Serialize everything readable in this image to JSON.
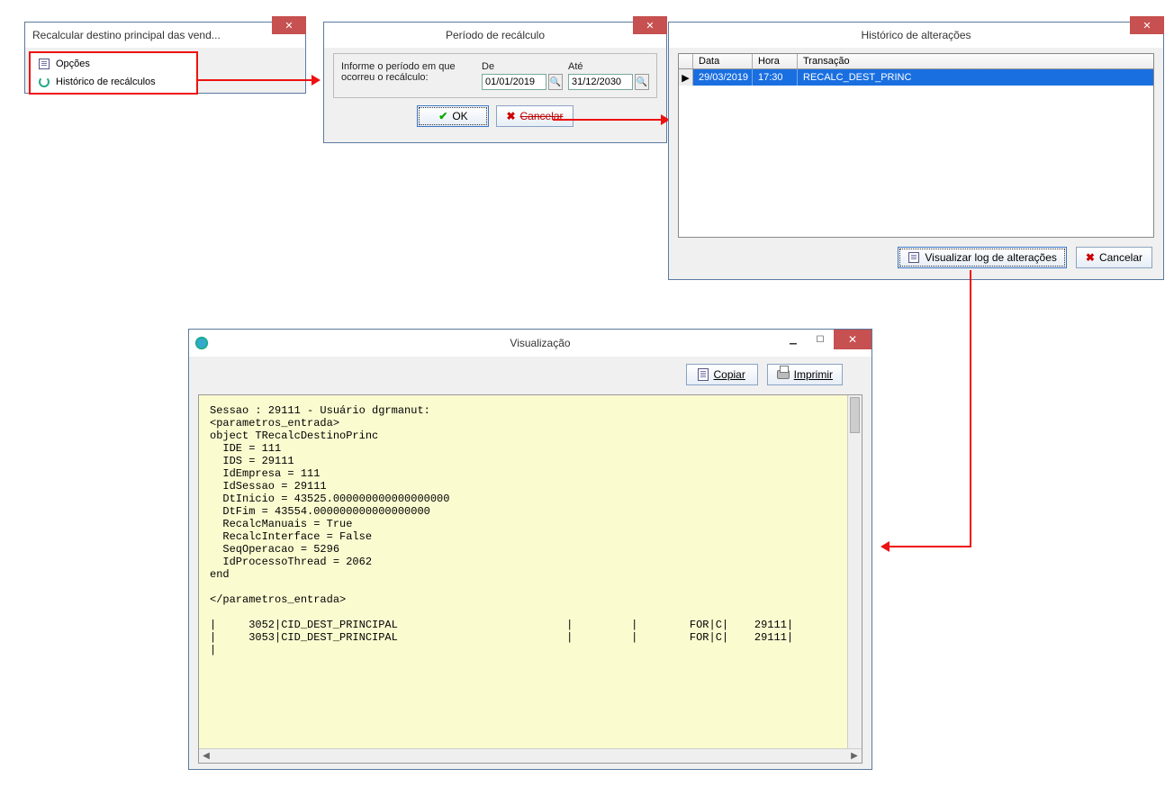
{
  "win1": {
    "title": "Recalcular destino principal das vend...",
    "menu": {
      "opcoes": "Opções",
      "historico": "Histórico de recálculos"
    }
  },
  "win2": {
    "title": "Período de recálculo",
    "instruction": "Informe o período em que ocorreu o recálculo:",
    "de_label": "De",
    "ate_label": "Até",
    "de_value": "01/01/2019",
    "ate_value": "31/12/2030",
    "ok": "OK",
    "cancel": "Cancelar"
  },
  "win3": {
    "title": "Histórico de alterações",
    "headers": {
      "data": "Data",
      "hora": "Hora",
      "transacao": "Transação"
    },
    "rows": [
      {
        "data": "29/03/2019",
        "hora": "17:30",
        "transacao": "RECALC_DEST_PRINC"
      }
    ],
    "btn_view": "Visualizar log de alterações",
    "btn_cancel": "Cancelar"
  },
  "win4": {
    "title": "Visualização",
    "btn_copy": "Copiar",
    "btn_print": "Imprimir",
    "log": "Sessao : 29111 - Usuário dgrmanut:\n<parametros_entrada>\nobject TRecalcDestinoPrinc\n  IDE = 111\n  IDS = 29111\n  IdEmpresa = 111\n  IdSessao = 29111\n  DtInicio = 43525.000000000000000000\n  DtFim = 43554.000000000000000000\n  RecalcManuais = True\n  RecalcInterface = False\n  SeqOperacao = 5296\n  IdProcessoThread = 2062\nend\n\n</parametros_entrada>\n\n|     3052|CID_DEST_PRINCIPAL                          |         |        FOR|C|    29111|\n|     3053|CID_DEST_PRINCIPAL                          |         |        FOR|C|    29111|\n|"
  }
}
